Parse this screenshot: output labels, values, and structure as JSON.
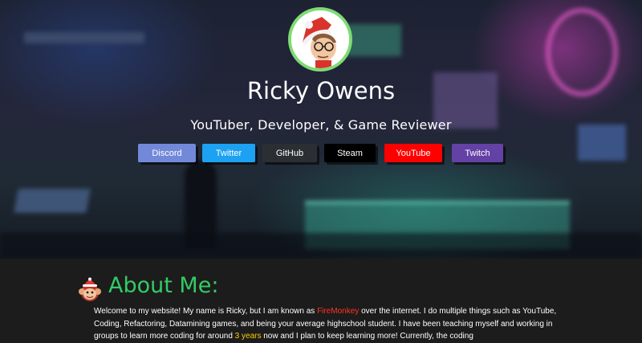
{
  "profile": {
    "name": "Ricky Owens",
    "tagline": "YouTuber, Developer, & Game Reviewer"
  },
  "links": [
    {
      "label": "Discord",
      "color": "#7289da"
    },
    {
      "label": "Twitter",
      "color": "#1da1f2"
    },
    {
      "label": "GitHub",
      "color": "#24292e"
    },
    {
      "label": "Steam",
      "color": "#000000"
    },
    {
      "label": "YouTube",
      "color": "#ff0000"
    },
    {
      "label": "Twitch",
      "color": "#6441a5"
    }
  ],
  "about": {
    "heading": "About Me:",
    "p1": "Welcome to my website! My name is Ricky, but I am known as ",
    "alias": "FireMonkey",
    "p2": " over the internet. I do multiple things such as YouTube, Coding, Refactoring, Datamining games, and being your average highschool student. I have been teaching myself and working in groups to learn more coding for around ",
    "years": "3 years",
    "p3": " now and I plan to keep learning more! Currently, the coding"
  },
  "colors": {
    "accent_green": "#33cc66",
    "avatar_ring": "#7ddc73",
    "highlight_red": "#ff3322",
    "highlight_yellow": "#ffcc00"
  }
}
